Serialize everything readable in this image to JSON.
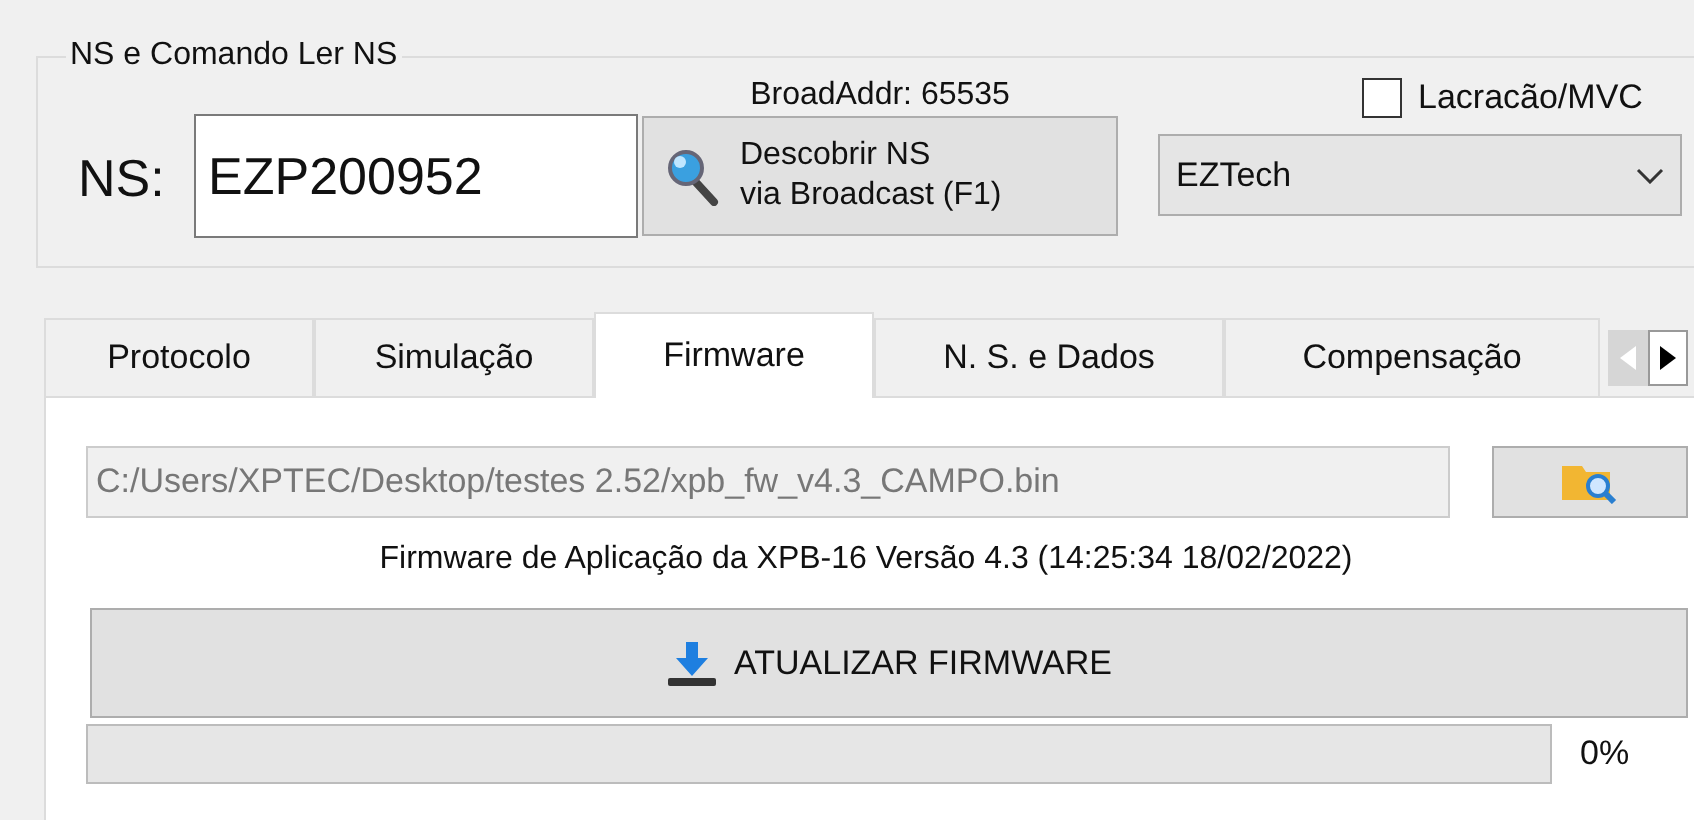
{
  "group": {
    "title": "NS e Comando Ler NS",
    "broad_addr": "BroadAddr: 65535",
    "ns_label": "NS:",
    "ns_value": "EZP200952",
    "discover_button": [
      "Descobrir NS",
      "via Broadcast (F1)"
    ],
    "checkbox": {
      "label": "Lacracão/MVC",
      "checked": false
    },
    "dropdown": {
      "value": "EZTech"
    }
  },
  "tabs": [
    {
      "label": "Protocolo",
      "selected": false
    },
    {
      "label": "Simulação",
      "selected": false
    },
    {
      "label": "Firmware",
      "selected": true
    },
    {
      "label": "N. S. e Dados",
      "selected": false
    },
    {
      "label": "Compensação",
      "selected": false
    }
  ],
  "firmware": {
    "path": "C:/Users/XPTEC/Desktop/testes 2.52/xpb_fw_v4.3_CAMPO.bin",
    "info": "Firmware de Aplicação da XPB-16 Versão 4.3 (14:25:34 18/02/2022)",
    "update_button": "ATUALIZAR FIRMWARE",
    "progress": {
      "level": 0,
      "reading": "0%"
    }
  }
}
